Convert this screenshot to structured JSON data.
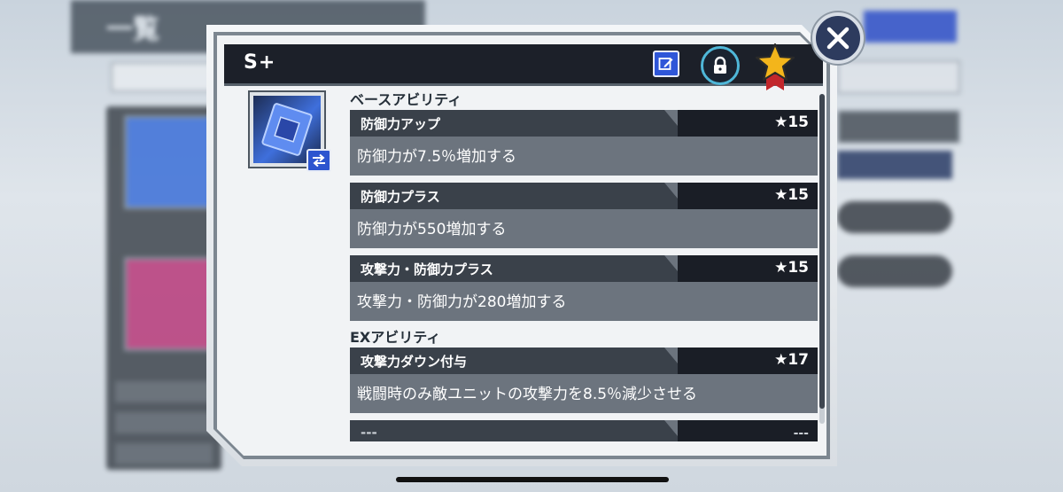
{
  "background": {
    "back_label": "一覧",
    "accent_color": "#2f50c8"
  },
  "dialog": {
    "grade": "S+",
    "icons": {
      "edit": "edit-icon",
      "lock": "lock-icon",
      "favorite": "star-icon",
      "close": "close-icon",
      "swap": "swap-icon"
    },
    "base_section_title": "ベースアビリティ",
    "ex_section_title": "EXアビリティ",
    "base_abilities": [
      {
        "name": "防御力アップ",
        "rank": "★15",
        "desc": "防御力が7.5％増加する"
      },
      {
        "name": "防御力プラス",
        "rank": "★15",
        "desc": "防御力が550増加する"
      },
      {
        "name": "攻撃力・防御力プラス",
        "rank": "★15",
        "desc": "攻撃力・防御力が280増加する"
      }
    ],
    "ex_abilities": [
      {
        "name": "攻撃力ダウン付与",
        "rank": "★17",
        "desc": "戦闘時のみ敵ユニットの攻撃力を8.5％減少させる"
      },
      {
        "name": "---",
        "rank": "---",
        "desc": ""
      }
    ]
  }
}
